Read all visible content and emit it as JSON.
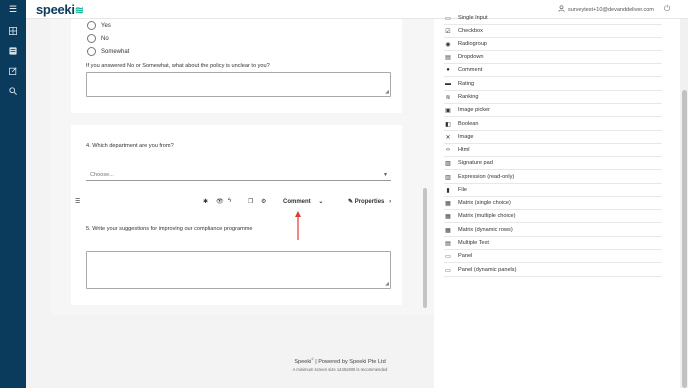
{
  "header": {
    "menu_icon": "hamburger-icon",
    "logo_text": "speeki",
    "user_email": "surveytest+10@devanddeliver.com"
  },
  "question_3": {
    "options": [
      "Yes",
      "No",
      "Somewhat"
    ],
    "followup_text": "If you answered No or Somewhat, what about the policy is unclear to you?"
  },
  "question_4": {
    "text": "4.   Which department are you from?",
    "dropdown_placeholder": "Choose..."
  },
  "question_toolbar": {
    "type_label": "Comment",
    "properties_label": "Properties"
  },
  "question_5": {
    "text": "5.   Write your suggestions for improving our compliance programme"
  },
  "footer": {
    "powered_brand": "Speeki",
    "powered_sup": "©",
    "powered_rest": "  |  Powered by Speeki Pte Ltd",
    "min_size_note": "A minimum screen size 1440x900 is recommended"
  },
  "toolbox": {
    "items": [
      {
        "label": "Single Input",
        "icon": "input-icon"
      },
      {
        "label": "Checkbox",
        "icon": "checkbox-icon"
      },
      {
        "label": "Radiogroup",
        "icon": "radiogroup-icon"
      },
      {
        "label": "Dropdown",
        "icon": "dropdown-icon"
      },
      {
        "label": "Comment",
        "icon": "comment-icon"
      },
      {
        "label": "Rating",
        "icon": "rating-icon"
      },
      {
        "label": "Ranking",
        "icon": "ranking-icon"
      },
      {
        "label": "Image picker",
        "icon": "image-picker-icon"
      },
      {
        "label": "Boolean",
        "icon": "boolean-icon"
      },
      {
        "label": "Image",
        "icon": "image-icon"
      },
      {
        "label": "Html",
        "icon": "html-icon"
      },
      {
        "label": "Signature pad",
        "icon": "signature-icon"
      },
      {
        "label": "Expression (read-only)",
        "icon": "expression-icon"
      },
      {
        "label": "File",
        "icon": "file-icon"
      },
      {
        "label": "Matrix (single choice)",
        "icon": "matrix-icon"
      },
      {
        "label": "Matrix (multiple choice)",
        "icon": "matrix-icon"
      },
      {
        "label": "Matrix (dynamic rows)",
        "icon": "matrix-icon"
      },
      {
        "label": "Multiple Text",
        "icon": "multiple-text-icon"
      },
      {
        "label": "Panel",
        "icon": "panel-icon"
      },
      {
        "label": "Panel (dynamic panels)",
        "icon": "panel-icon"
      }
    ]
  },
  "colors": {
    "sidebar": "#0b3b5c",
    "accent": "#19b5a5",
    "arrow": "#e53935"
  }
}
